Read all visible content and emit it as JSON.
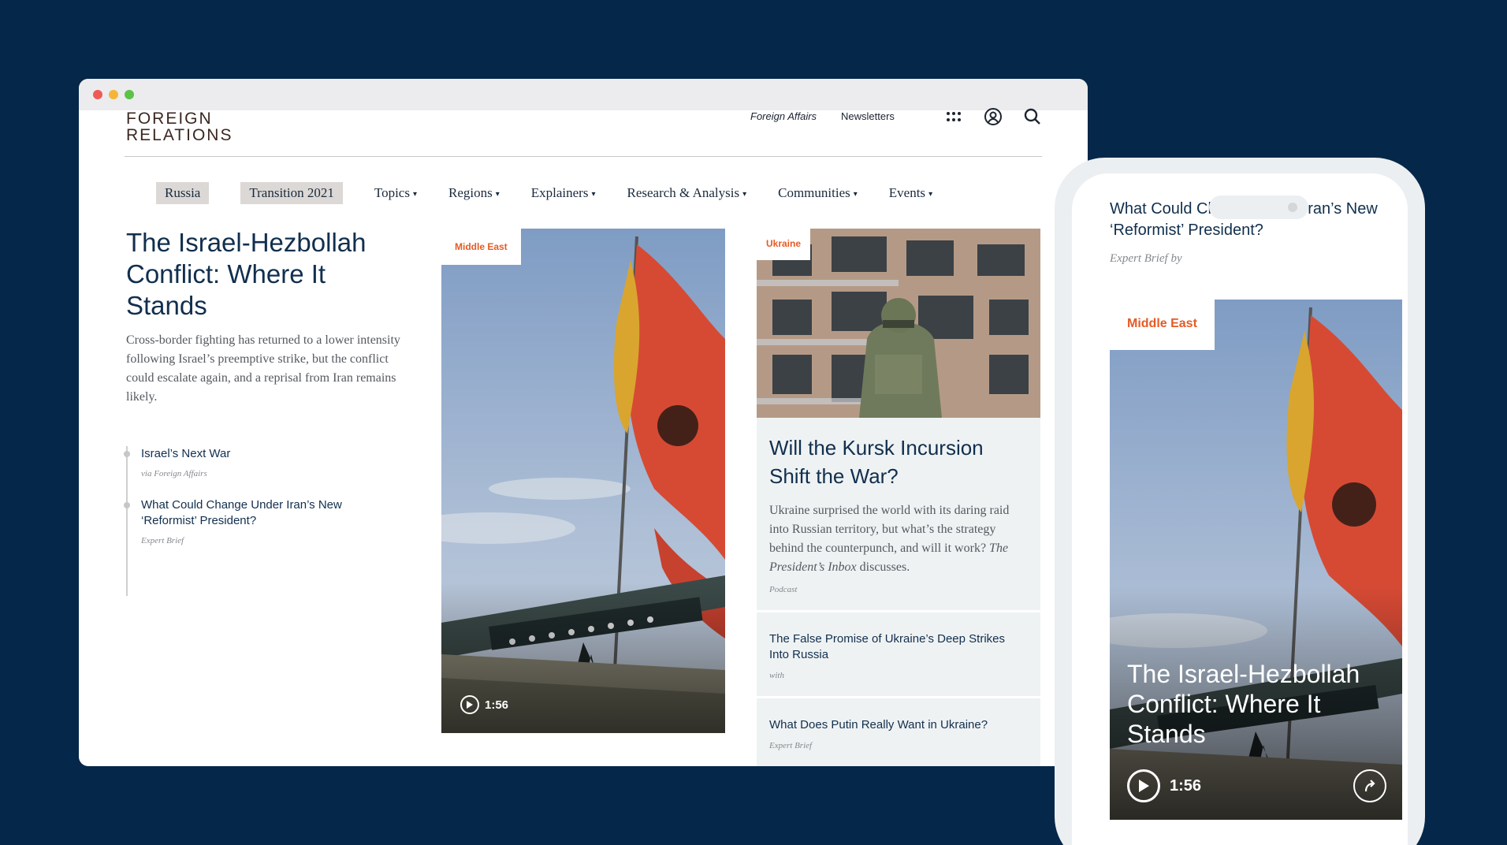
{
  "site": {
    "logo_line1": "FOREIGN",
    "logo_line2": "RELATIONS",
    "top_links": [
      "Foreign Affairs",
      "Newsletters"
    ],
    "icons": [
      "grid-menu-icon",
      "user-icon",
      "search-icon"
    ]
  },
  "nav": {
    "pills": [
      "Russia",
      "Transition 2021"
    ],
    "items": [
      "Topics",
      "Regions",
      "Explainers",
      "Research & Analysis",
      "Communities",
      "Events"
    ]
  },
  "lead": {
    "headline": "The Israel-Hezbollah Conflict: Where It Stands",
    "dek": "Cross-border fighting has returned to a lower intensity following Israel’s preemptive strike, but the conflict could escalate again, and a reprisal from Iran remains likely.",
    "related": [
      {
        "title": "Israel’s Next War",
        "meta": "via Foreign Affairs"
      },
      {
        "title": "What Could Change Under Iran’s New ‘Reformist’ President?",
        "meta": "Expert Brief"
      }
    ]
  },
  "feature": {
    "tag": "Middle East",
    "duration": "1:56"
  },
  "right": {
    "tag": "Ukraine",
    "title": "Will the Kursk Incursion Shift the War?",
    "dek_part1": "Ukraine surprised the world with its daring raid into Russian territory, but what’s the strategy behind the counterpunch, and will it work?",
    "dek_italic": "The President’s Inbox",
    "dek_part2": "discusses.",
    "meta": "Podcast",
    "items": [
      {
        "title": "The False Promise of Ukraine’s Deep Strikes Into Russia",
        "meta": "with"
      },
      {
        "title": "What Does Putin Really Want in Ukraine?",
        "meta": "Expert Brief"
      }
    ]
  },
  "phone": {
    "title": "What Could Change Under Iran’s New ‘Reformist’ President?",
    "meta": "Expert Brief by",
    "tag": "Middle East",
    "headline": "The Israel-Hezbollah Conflict: Where It Stands",
    "duration": "1:56"
  }
}
